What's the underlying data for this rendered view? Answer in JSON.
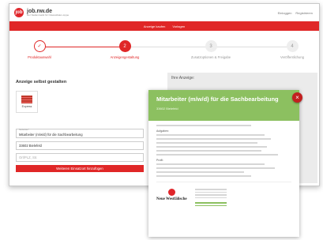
{
  "header": {
    "logo_mark": "job",
    "site_name": "job.nw.de",
    "tagline": "Der Stellenmarkt für Ostwestfalen-Lippe",
    "links": [
      "Einloggen",
      "Registrieren"
    ]
  },
  "nav": {
    "items": [
      "Anzeige kaufen",
      "Vorlagen"
    ]
  },
  "steps": [
    {
      "label": "Produktauswahl",
      "symbol": "✓",
      "state": "done"
    },
    {
      "label": "Anzeigengestaltung",
      "symbol": "2",
      "state": "active"
    },
    {
      "label": "Zusatzoptionen & Freigabe",
      "symbol": "3",
      "state": "todo"
    },
    {
      "label": "Veröffentlichung",
      "symbol": "4",
      "state": "todo"
    }
  ],
  "form": {
    "title": "Anzeige selbst gestalten",
    "product_label": "Express",
    "job_title_label": "Stellentitel *",
    "job_title_value": "Mitarbeiter (m/w/d) für die Sachbearbeitung",
    "location_value": "33602 Bielefeld",
    "extra_placeholder": "Ort/PLZ, Str.",
    "add_location_button": "Weiteren Einsatzort hinzufügen"
  },
  "preview": {
    "title": "Ihre Anzeige:"
  },
  "modal": {
    "title": "Mitarbeiter (m/w/d) für die Sachbearbeitung",
    "subtitle": "33602 Bielefeld",
    "close_symbol": "×",
    "section1": "Aufgaben:",
    "section2": "Profil:",
    "brand": "Neue Westfälische"
  },
  "colors": {
    "accent": "#e02727",
    "modal_header": "#8cc060"
  }
}
